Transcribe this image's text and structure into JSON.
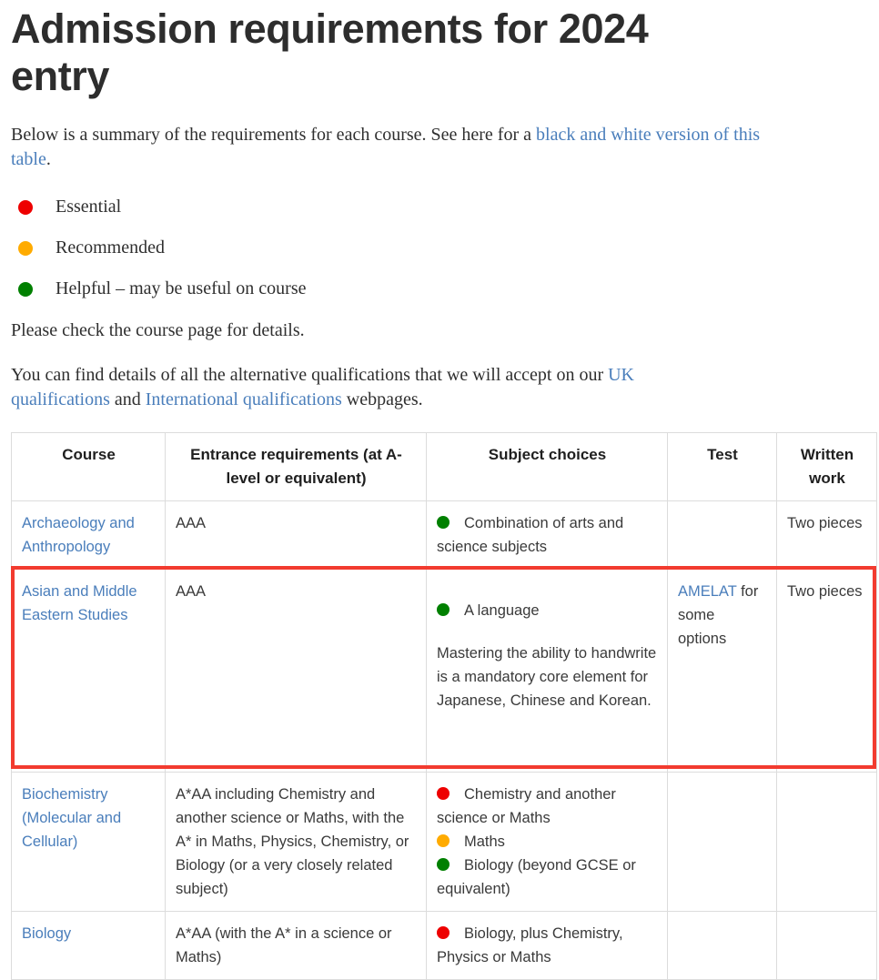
{
  "page": {
    "title": "Admission requirements for 2024 entry",
    "intro_before": "Below is a summary of the requirements for each course. See here for a ",
    "intro_link": "black and white version of this table",
    "intro_after": ".",
    "note": "Please check the course page for details.",
    "alt_before": "You can find details of all the alternative qualifications that we will accept on our ",
    "alt_link_1": "UK qualifications",
    "alt_middle": " and ",
    "alt_link_2": "International qualifications",
    "alt_after": " webpages."
  },
  "colors": {
    "essential": "#ee0000",
    "recommended": "#ffab00",
    "helpful": "#008000",
    "link": "#4a7ebb",
    "highlight": "#f23b2f",
    "heading": "#2d2d2d"
  },
  "legend": [
    {
      "key": "essential",
      "label": "Essential",
      "color": "#ee0000"
    },
    {
      "key": "recommended",
      "label": "Recommended",
      "color": "#ffab00"
    },
    {
      "key": "helpful",
      "label": "Helpful – may be useful on course",
      "color": "#008000"
    }
  ],
  "table": {
    "headers": [
      "Course",
      "Entrance requirements (at A-level or equivalent)",
      "Subject choices",
      "Test",
      "Written work"
    ],
    "rows": [
      {
        "course": "Archaeology and Anthropology",
        "entrance": "AAA",
        "subject_items": [
          {
            "dot": "helpful",
            "color": "#008000",
            "text": "Combination of arts and science subjects"
          }
        ],
        "subject_note": "",
        "test_link": "",
        "test_rest": "",
        "written": "Two pieces",
        "highlighted": false
      },
      {
        "course": "Asian and Middle Eastern Studies",
        "entrance": "AAA",
        "subject_items": [
          {
            "dot": "helpful",
            "color": "#008000",
            "text": "A language"
          }
        ],
        "subject_note": "Mastering the ability to handwrite is a mandatory core element for Japanese, Chinese and Korean.",
        "test_link": "AMELAT",
        "test_rest": " for some options",
        "written": "Two pieces",
        "highlighted": true
      },
      {
        "course": "Biochemistry (Molecular and Cellular)",
        "entrance": "A*AA including Chemistry and another science or Maths, with the A* in Maths, Physics, Chemistry, or Biology (or a very closely related subject)",
        "subject_items": [
          {
            "dot": "essential",
            "color": "#ee0000",
            "text": "Chemistry and another science or Maths"
          },
          {
            "dot": "recommended",
            "color": "#ffab00",
            "text": "Maths"
          },
          {
            "dot": "helpful",
            "color": "#008000",
            "text": "Biology (beyond GCSE or equivalent)"
          }
        ],
        "subject_note": "",
        "test_link": "",
        "test_rest": "",
        "written": "",
        "highlighted": false
      },
      {
        "course": "Biology",
        "entrance": "A*AA (with the A* in a science or Maths)",
        "subject_items": [
          {
            "dot": "essential",
            "color": "#ee0000",
            "text": "Biology, plus Chemistry, Physics or Maths"
          }
        ],
        "subject_note": "",
        "test_link": "",
        "test_rest": "",
        "written": "",
        "highlighted": false
      }
    ]
  }
}
